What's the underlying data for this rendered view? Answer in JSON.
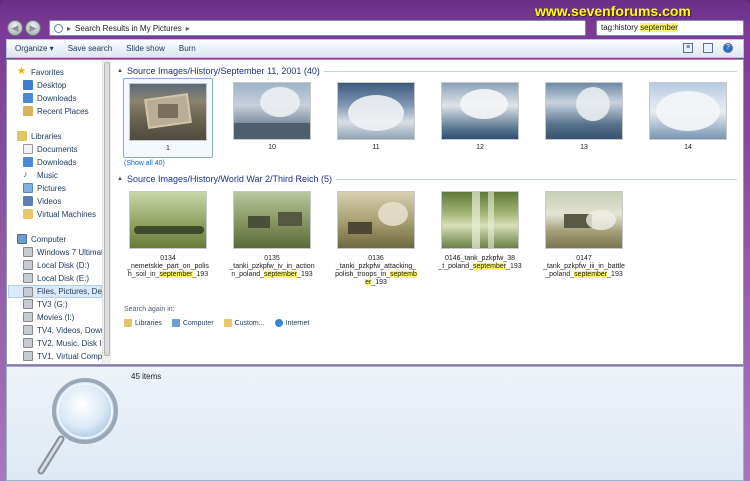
{
  "window": {
    "address": "Search Results in My Pictures",
    "search_value": "tag:history september",
    "watermark": "www.sevenforums.com"
  },
  "toolbar": {
    "organize": "Organize ▾",
    "save_search": "Save search",
    "slide_show": "Slide show",
    "burn": "Burn"
  },
  "nav": {
    "favorites": "Favorites",
    "desktop": "Desktop",
    "downloads": "Downloads",
    "recent": "Recent Places",
    "libraries": "Libraries",
    "documents": "Documents",
    "lib_downloads": "Downloads",
    "music": "Music",
    "pictures": "Pictures",
    "videos": "Videos",
    "virtual_machines": "Virtual Machines",
    "computer": "Computer",
    "drive_c": "Windows 7 Ultimate",
    "drive_d": "Local Disk (D:)",
    "drive_e": "Local Disk (E:)",
    "drive_f": "Files, Pictures, Dev (F",
    "drive_g": "TV3 (G:)",
    "drive_i": "Movies (I:)",
    "drive_tv4": "TV4, Videos, Downl",
    "drive_tv2": "TV2, Music, Disk Im",
    "drive_tv1": "TV1, Virtual Compu"
  },
  "groups": [
    {
      "title": "Source Images/History/September 11, 2001 (40)",
      "show_all": "(Show all 40)",
      "items": [
        {
          "name": "1"
        },
        {
          "name": "10"
        },
        {
          "name": "11"
        },
        {
          "name": "12"
        },
        {
          "name": "13"
        },
        {
          "name": "14"
        }
      ]
    },
    {
      "title": "Source Images/History/World War 2/Third Reich (5)",
      "items": [
        {
          "l1": "0134",
          "l2": "_nemetskie_part_on_polis",
          "l3a": "h_soil_in_",
          "l3b": "september",
          "l3c": "_193"
        },
        {
          "l1": "0135",
          "l2": "_tanki_pzkpfw_iv_in_action",
          "l3a": "n_poland_",
          "l3b": "september",
          "l3c": "_193"
        },
        {
          "l1": "0136",
          "l2": "_tanki_pzkpfw_attacking_",
          "l3a": "polish_troops_in_",
          "l3b": "septemb",
          "l3c": "",
          "l4": "er",
          "l4b": "_193"
        },
        {
          "l1": "0146_tank_pzkpfw_38",
          "l2": "",
          "l3a": "_t_poland_",
          "l3b": "september",
          "l3c": "_193"
        },
        {
          "l1": "0147",
          "l2": "_tank_pzkpfw_iii_in_battle",
          "l3a": "_poland_",
          "l3b": "september",
          "l3c": "_193"
        }
      ]
    }
  ],
  "search_again": {
    "label": "Search again in:",
    "libraries": "Libraries",
    "computer": "Computer",
    "custom": "Custom...",
    "internet": "Internet"
  },
  "status": {
    "count": "45 items"
  }
}
